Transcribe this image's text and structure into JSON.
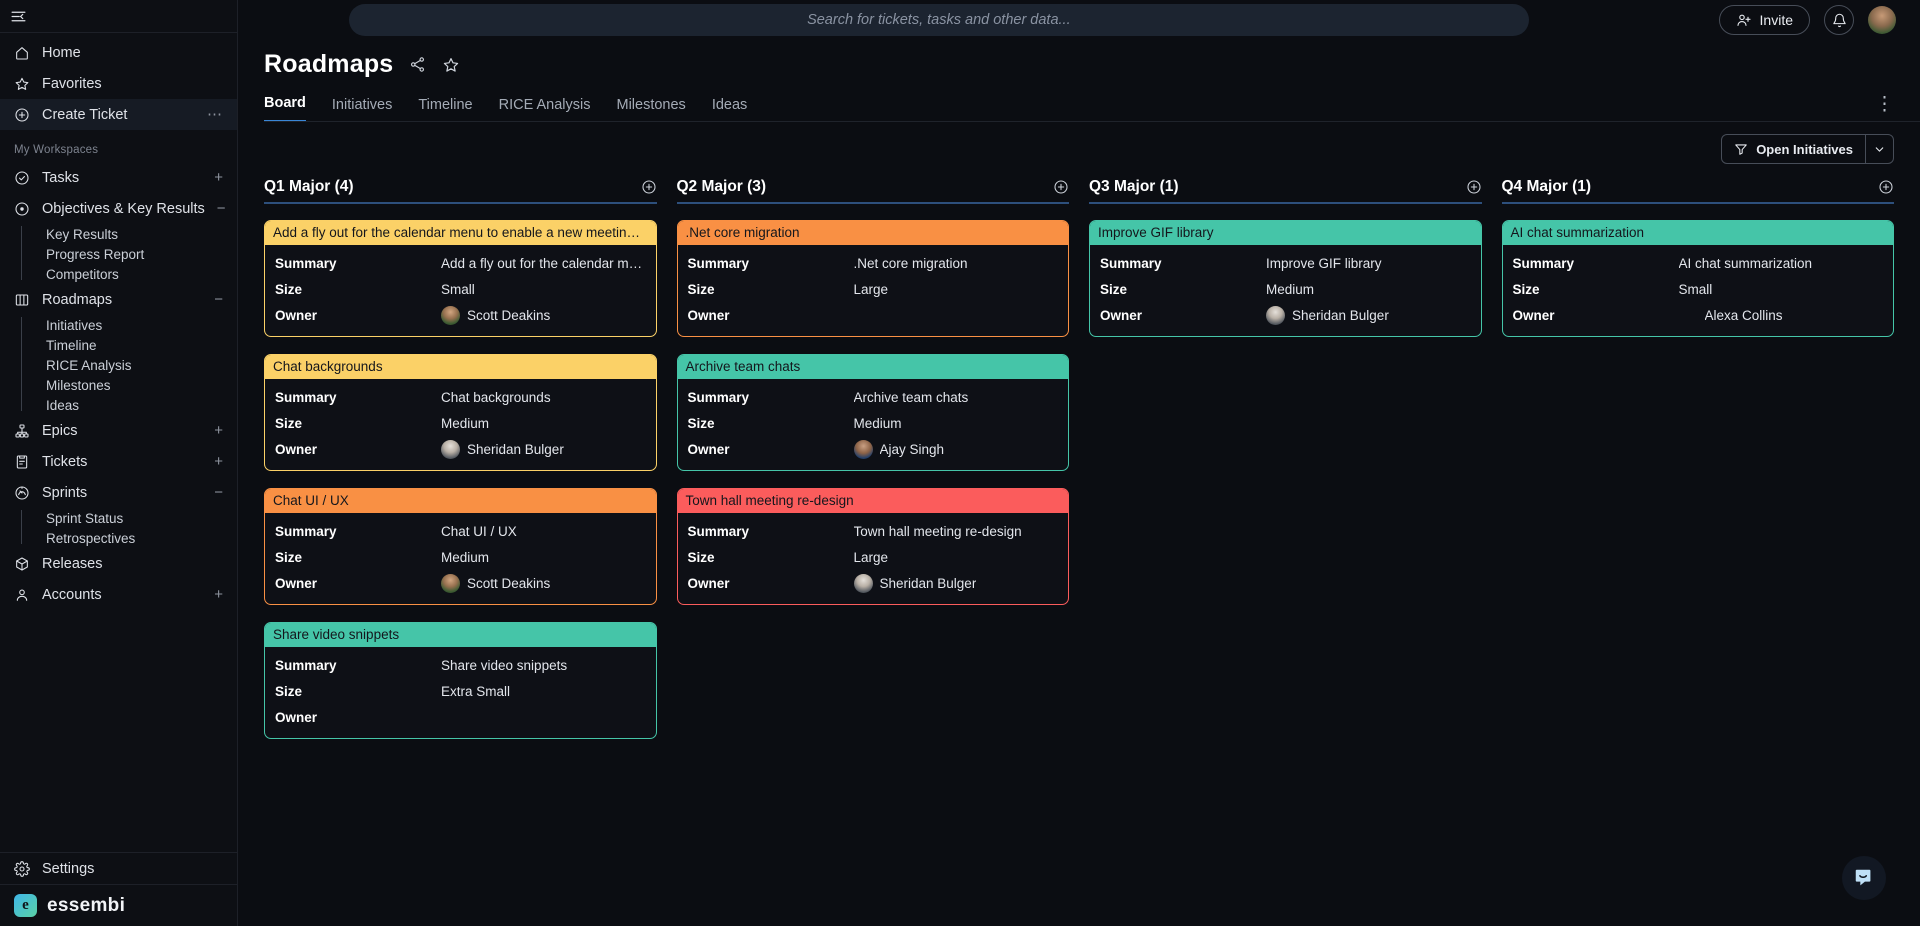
{
  "sidebar": {
    "collapse_icon": "sidebar-toggle-icon",
    "primary": [
      {
        "icon": "home-icon",
        "label": "Home",
        "active": false
      },
      {
        "icon": "star-icon",
        "label": "Favorites",
        "active": false
      },
      {
        "icon": "plus-circle-icon",
        "label": "Create Ticket",
        "active": true,
        "right": "⋯"
      }
    ],
    "section_label": "My Workspaces",
    "groups": [
      {
        "icon": "check-circle-icon",
        "label": "Tasks",
        "toggle": "+",
        "children": []
      },
      {
        "icon": "target-icon",
        "label": "Objectives & Key Results",
        "toggle": "−",
        "children": [
          "Key Results",
          "Progress Report",
          "Competitors"
        ]
      },
      {
        "icon": "board-icon",
        "label": "Roadmaps",
        "toggle": "−",
        "children": [
          "Initiatives",
          "Timeline",
          "RICE Analysis",
          "Milestones",
          "Ideas"
        ]
      },
      {
        "icon": "epics-icon",
        "label": "Epics",
        "toggle": "+",
        "children": []
      },
      {
        "icon": "ticket-icon",
        "label": "Tickets",
        "toggle": "+",
        "children": []
      },
      {
        "icon": "sprint-icon",
        "label": "Sprints",
        "toggle": "−",
        "children": [
          "Sprint Status",
          "Retrospectives"
        ]
      },
      {
        "icon": "cube-icon",
        "label": "Releases",
        "toggle": "",
        "children": []
      },
      {
        "icon": "person-icon",
        "label": "Accounts",
        "toggle": "+",
        "children": []
      }
    ],
    "settings": {
      "icon": "gear-icon",
      "label": "Settings"
    },
    "brand": {
      "mark": "e",
      "name": "essembi"
    }
  },
  "topbar": {
    "search_placeholder": "Search for tickets, tasks and other data...",
    "invite_label": "Invite",
    "invite_icon": "user-plus-icon",
    "bell_icon": "bell-icon",
    "avatar": "user-avatar"
  },
  "header": {
    "title": "Roadmaps",
    "share_icon": "share-icon",
    "favorite_icon": "star-outline-icon",
    "kebab_icon": "more-vertical-icon",
    "tabs": [
      {
        "label": "Board",
        "active": true
      },
      {
        "label": "Initiatives",
        "active": false
      },
      {
        "label": "Timeline",
        "active": false
      },
      {
        "label": "RICE Analysis",
        "active": false
      },
      {
        "label": "Milestones",
        "active": false
      },
      {
        "label": "Ideas",
        "active": false
      }
    ]
  },
  "filter": {
    "icon": "filter-icon",
    "label": "Open Initiatives",
    "caret_icon": "chevron-down-icon"
  },
  "board": {
    "field_labels": {
      "summary": "Summary",
      "size": "Size",
      "owner": "Owner"
    },
    "add_icon": "plus-circle-icon",
    "accent": "#3a86d6",
    "columns": [
      {
        "title": "Q1 Major (4)",
        "cards": [
          {
            "title": "Add a fly out for the calendar menu to enable a new meetin…",
            "color": "#FBD167",
            "summary": "Add a fly out for the calendar men…",
            "size": "Small",
            "owner": "Scott Deakins",
            "owner_avatar": "av-scott"
          },
          {
            "title": "Chat backgrounds",
            "color": "#FBD167",
            "summary": "Chat backgrounds",
            "size": "Medium",
            "owner": "Sheridan Bulger",
            "owner_avatar": "av-sheridan"
          },
          {
            "title": "Chat UI / UX",
            "color": "#F99044",
            "summary": "Chat UI / UX",
            "size": "Medium",
            "owner": "Scott Deakins",
            "owner_avatar": "av-scott"
          },
          {
            "title": "Share video snippets",
            "color": "#45C5A8",
            "summary": "Share video snippets",
            "size": "Extra Small",
            "owner": "",
            "owner_avatar": ""
          }
        ]
      },
      {
        "title": "Q2 Major (3)",
        "cards": [
          {
            "title": ".Net core migration",
            "color": "#F99044",
            "summary": ".Net core migration",
            "size": "Large",
            "owner": "",
            "owner_avatar": ""
          },
          {
            "title": "Archive team chats",
            "color": "#45C5A8",
            "summary": "Archive team chats",
            "size": "Medium",
            "owner": "Ajay Singh",
            "owner_avatar": "av-ajay"
          },
          {
            "title": "Town hall meeting re-design",
            "color": "#FB5C5C",
            "summary": "Town hall meeting re-design",
            "size": "Large",
            "owner": "Sheridan Bulger",
            "owner_avatar": "av-sheridan"
          }
        ]
      },
      {
        "title": "Q3 Major (1)",
        "cards": [
          {
            "title": "Improve GIF library",
            "color": "#45C5A8",
            "summary": "Improve GIF library",
            "size": "Medium",
            "owner": "Sheridan Bulger",
            "owner_avatar": "av-sheridan"
          }
        ]
      },
      {
        "title": "Q4 Major (1)",
        "cards": [
          {
            "title": "AI chat summarization",
            "color": "#45C5A8",
            "summary": "AI chat summarization",
            "size": "Small",
            "owner": "Alexa Collins",
            "owner_avatar": "av-alexa"
          }
        ]
      }
    ]
  },
  "chat_widget": {
    "icon": "chat-bubble-icon"
  }
}
